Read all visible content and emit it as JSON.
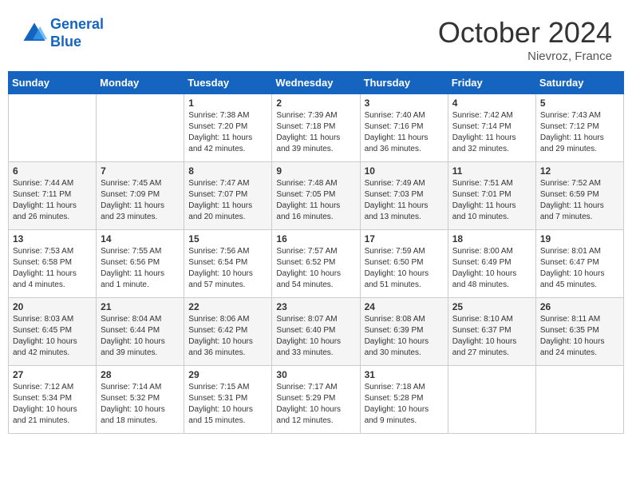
{
  "header": {
    "logo_line1": "General",
    "logo_line2": "Blue",
    "month_title": "October 2024",
    "location": "Nievroz, France"
  },
  "weekdays": [
    "Sunday",
    "Monday",
    "Tuesday",
    "Wednesday",
    "Thursday",
    "Friday",
    "Saturday"
  ],
  "weeks": [
    [
      {
        "day": "",
        "content": ""
      },
      {
        "day": "",
        "content": ""
      },
      {
        "day": "1",
        "content": "Sunrise: 7:38 AM\nSunset: 7:20 PM\nDaylight: 11 hours and 42 minutes."
      },
      {
        "day": "2",
        "content": "Sunrise: 7:39 AM\nSunset: 7:18 PM\nDaylight: 11 hours and 39 minutes."
      },
      {
        "day": "3",
        "content": "Sunrise: 7:40 AM\nSunset: 7:16 PM\nDaylight: 11 hours and 36 minutes."
      },
      {
        "day": "4",
        "content": "Sunrise: 7:42 AM\nSunset: 7:14 PM\nDaylight: 11 hours and 32 minutes."
      },
      {
        "day": "5",
        "content": "Sunrise: 7:43 AM\nSunset: 7:12 PM\nDaylight: 11 hours and 29 minutes."
      }
    ],
    [
      {
        "day": "6",
        "content": "Sunrise: 7:44 AM\nSunset: 7:11 PM\nDaylight: 11 hours and 26 minutes."
      },
      {
        "day": "7",
        "content": "Sunrise: 7:45 AM\nSunset: 7:09 PM\nDaylight: 11 hours and 23 minutes."
      },
      {
        "day": "8",
        "content": "Sunrise: 7:47 AM\nSunset: 7:07 PM\nDaylight: 11 hours and 20 minutes."
      },
      {
        "day": "9",
        "content": "Sunrise: 7:48 AM\nSunset: 7:05 PM\nDaylight: 11 hours and 16 minutes."
      },
      {
        "day": "10",
        "content": "Sunrise: 7:49 AM\nSunset: 7:03 PM\nDaylight: 11 hours and 13 minutes."
      },
      {
        "day": "11",
        "content": "Sunrise: 7:51 AM\nSunset: 7:01 PM\nDaylight: 11 hours and 10 minutes."
      },
      {
        "day": "12",
        "content": "Sunrise: 7:52 AM\nSunset: 6:59 PM\nDaylight: 11 hours and 7 minutes."
      }
    ],
    [
      {
        "day": "13",
        "content": "Sunrise: 7:53 AM\nSunset: 6:58 PM\nDaylight: 11 hours and 4 minutes."
      },
      {
        "day": "14",
        "content": "Sunrise: 7:55 AM\nSunset: 6:56 PM\nDaylight: 11 hours and 1 minute."
      },
      {
        "day": "15",
        "content": "Sunrise: 7:56 AM\nSunset: 6:54 PM\nDaylight: 10 hours and 57 minutes."
      },
      {
        "day": "16",
        "content": "Sunrise: 7:57 AM\nSunset: 6:52 PM\nDaylight: 10 hours and 54 minutes."
      },
      {
        "day": "17",
        "content": "Sunrise: 7:59 AM\nSunset: 6:50 PM\nDaylight: 10 hours and 51 minutes."
      },
      {
        "day": "18",
        "content": "Sunrise: 8:00 AM\nSunset: 6:49 PM\nDaylight: 10 hours and 48 minutes."
      },
      {
        "day": "19",
        "content": "Sunrise: 8:01 AM\nSunset: 6:47 PM\nDaylight: 10 hours and 45 minutes."
      }
    ],
    [
      {
        "day": "20",
        "content": "Sunrise: 8:03 AM\nSunset: 6:45 PM\nDaylight: 10 hours and 42 minutes."
      },
      {
        "day": "21",
        "content": "Sunrise: 8:04 AM\nSunset: 6:44 PM\nDaylight: 10 hours and 39 minutes."
      },
      {
        "day": "22",
        "content": "Sunrise: 8:06 AM\nSunset: 6:42 PM\nDaylight: 10 hours and 36 minutes."
      },
      {
        "day": "23",
        "content": "Sunrise: 8:07 AM\nSunset: 6:40 PM\nDaylight: 10 hours and 33 minutes."
      },
      {
        "day": "24",
        "content": "Sunrise: 8:08 AM\nSunset: 6:39 PM\nDaylight: 10 hours and 30 minutes."
      },
      {
        "day": "25",
        "content": "Sunrise: 8:10 AM\nSunset: 6:37 PM\nDaylight: 10 hours and 27 minutes."
      },
      {
        "day": "26",
        "content": "Sunrise: 8:11 AM\nSunset: 6:35 PM\nDaylight: 10 hours and 24 minutes."
      }
    ],
    [
      {
        "day": "27",
        "content": "Sunrise: 7:12 AM\nSunset: 5:34 PM\nDaylight: 10 hours and 21 minutes."
      },
      {
        "day": "28",
        "content": "Sunrise: 7:14 AM\nSunset: 5:32 PM\nDaylight: 10 hours and 18 minutes."
      },
      {
        "day": "29",
        "content": "Sunrise: 7:15 AM\nSunset: 5:31 PM\nDaylight: 10 hours and 15 minutes."
      },
      {
        "day": "30",
        "content": "Sunrise: 7:17 AM\nSunset: 5:29 PM\nDaylight: 10 hours and 12 minutes."
      },
      {
        "day": "31",
        "content": "Sunrise: 7:18 AM\nSunset: 5:28 PM\nDaylight: 10 hours and 9 minutes."
      },
      {
        "day": "",
        "content": ""
      },
      {
        "day": "",
        "content": ""
      }
    ]
  ]
}
